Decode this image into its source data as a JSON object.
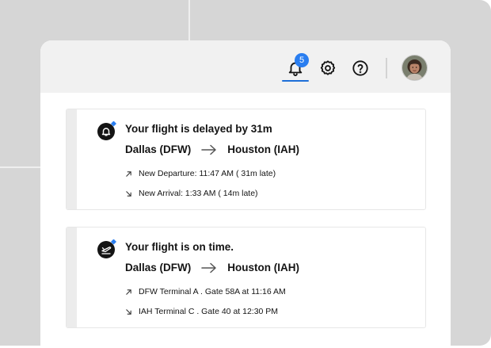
{
  "topbar": {
    "notifications": {
      "icon": "bell-icon",
      "badge_count": "5",
      "badge_color": "#2a7ef0",
      "active_underline_color": "#1d6fd8"
    },
    "settings": {
      "icon": "gear-icon"
    },
    "help": {
      "icon": "question-circle-icon"
    },
    "avatar": {
      "icon": "user-avatar"
    }
  },
  "cards": [
    {
      "icon": "bell-alert-icon",
      "title": "Your flight is delayed by 31m",
      "origin": "Dallas (DFW)",
      "destination": "Houston (IAH)",
      "details": [
        {
          "icon": "arrow-up-right-icon",
          "text": "New Departure: 11:47 AM ( 31m late)"
        },
        {
          "icon": "arrow-down-right-icon",
          "text": "New Arrival: 1:33 AM ( 14m late)"
        }
      ]
    },
    {
      "icon": "plane-departure-icon",
      "title": "Your flight is on time.",
      "origin": "Dallas (DFW)",
      "destination": "Houston (IAH)",
      "details": [
        {
          "icon": "arrow-up-right-icon",
          "text": "DFW Terminal A . Gate 58A at 11:16 AM"
        },
        {
          "icon": "arrow-down-right-icon",
          "text": "IAH Terminal C . Gate 40 at 12:30 PM"
        }
      ]
    }
  ]
}
